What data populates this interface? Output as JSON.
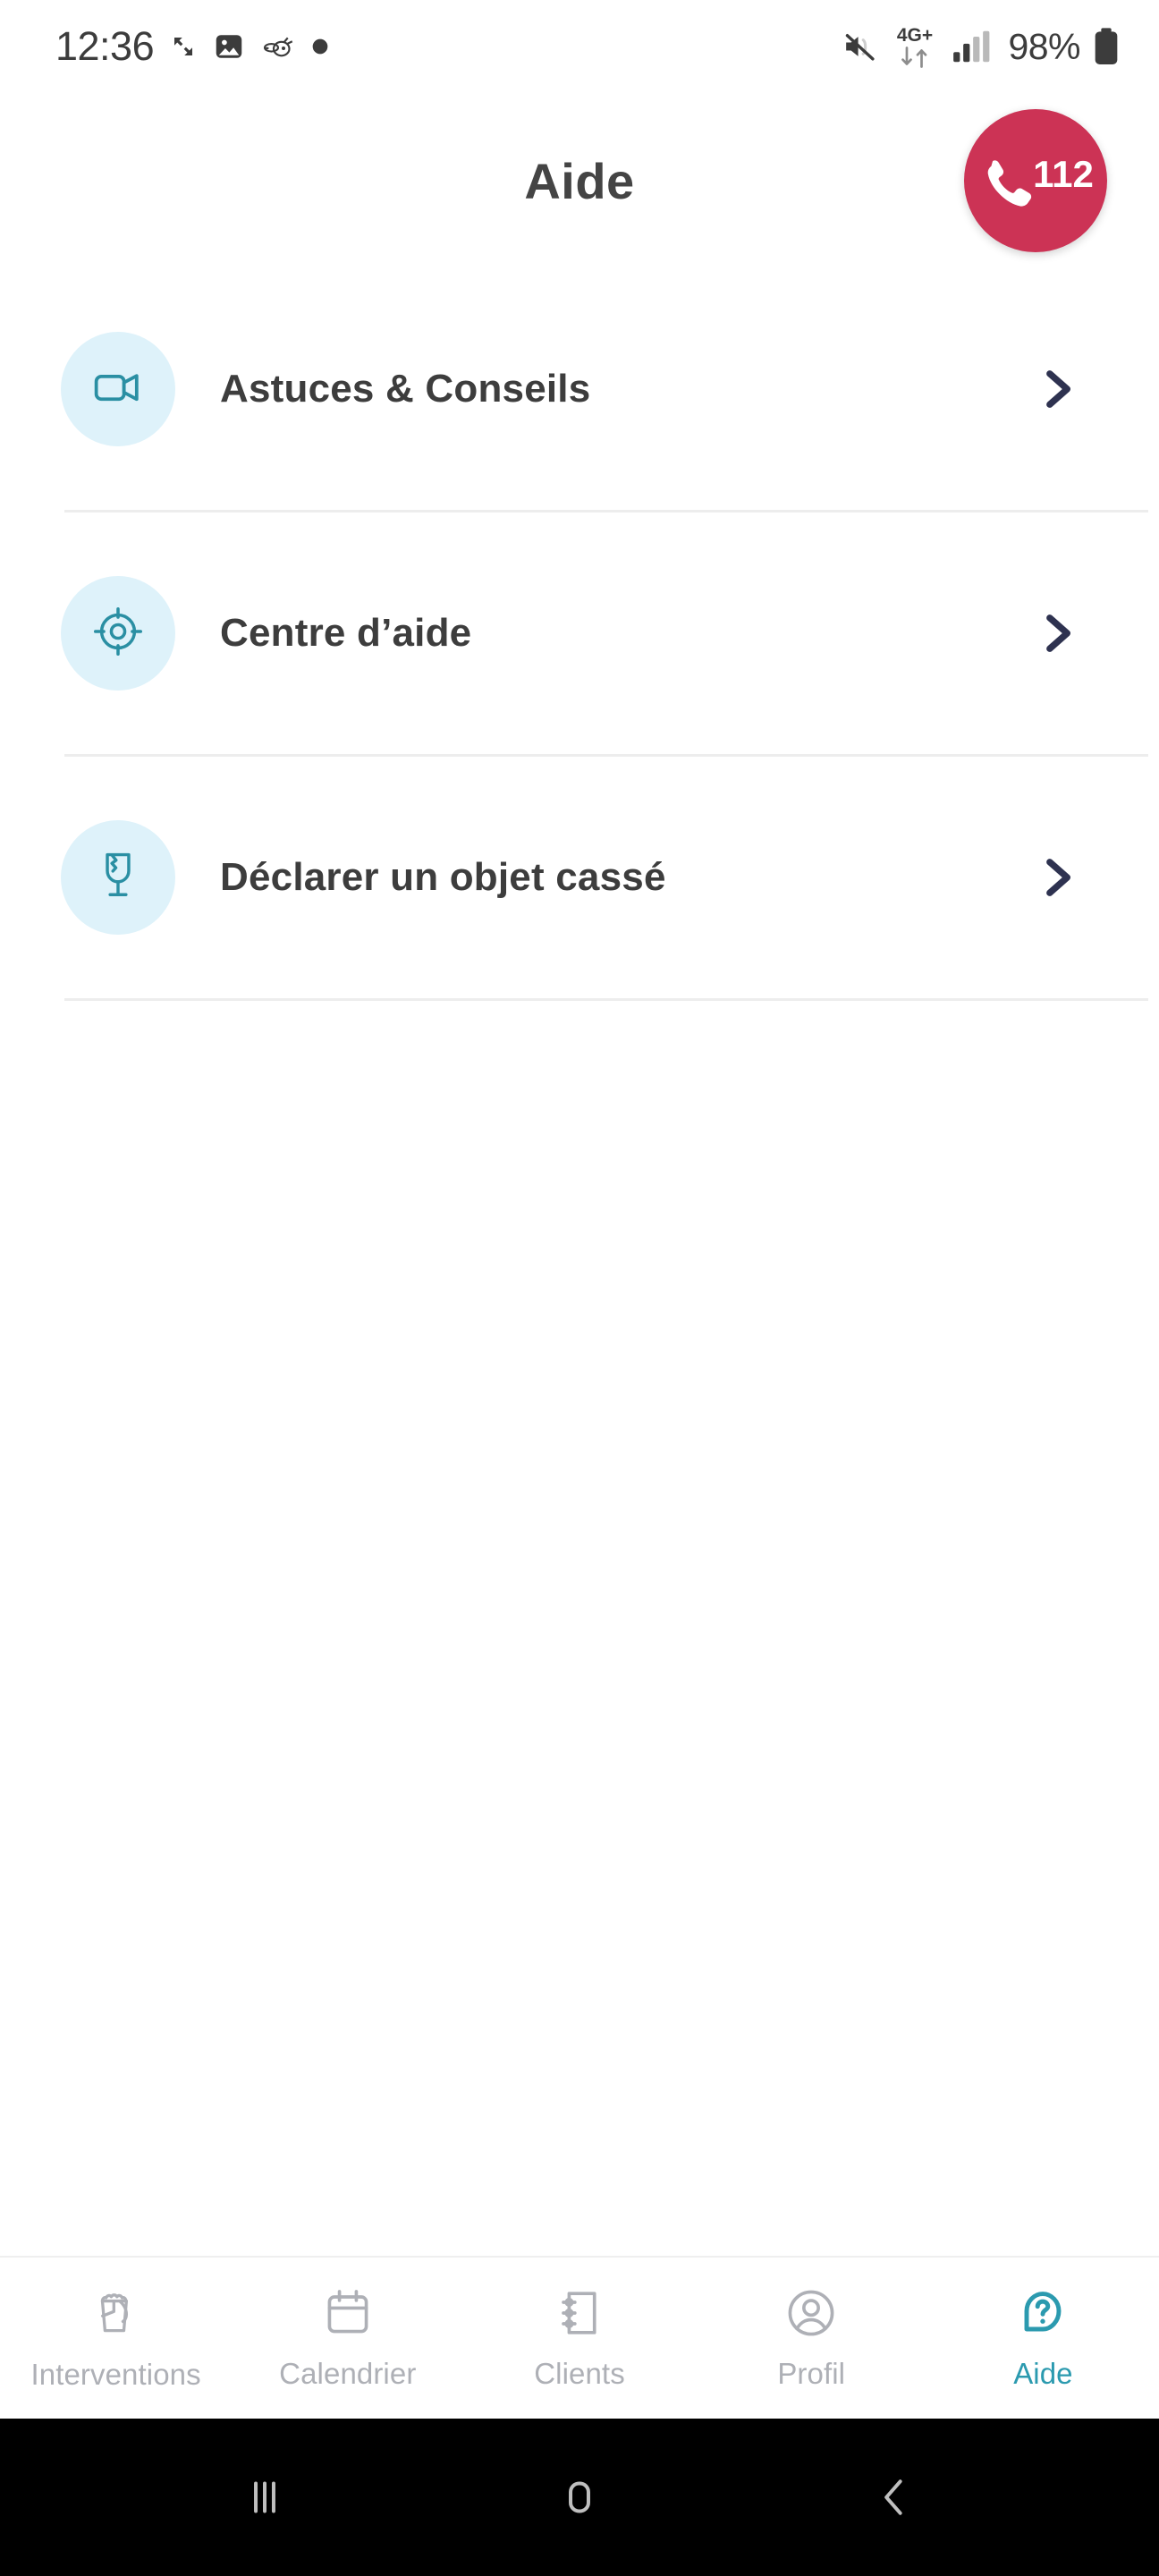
{
  "status_bar": {
    "time": "12:36",
    "battery_percent": "98%",
    "network": "4G+",
    "left_icons": [
      "screen-rotate-icon",
      "image-icon",
      "bee-icon",
      "dot-icon"
    ],
    "right_icons": [
      "mute-icon",
      "network-4gplus-icon",
      "signal-bars-icon",
      "battery-icon"
    ]
  },
  "header": {
    "title": "Aide",
    "emergency": {
      "number": "112",
      "icon": "phone-icon",
      "color": "#CC3355"
    }
  },
  "theme": {
    "accent_teal": "#2B9AAF",
    "icon_bubble_bg": "#DEF2FA",
    "chevron": "#2E3250",
    "text_dark": "#3D3D3D",
    "nav_inactive": "#AEB0B6",
    "divider": "#EDEDED"
  },
  "menu": {
    "items": [
      {
        "label": "Astuces & Conseils",
        "icon": "video-camera-icon",
        "chevron": "chevron-right-icon"
      },
      {
        "label": "Centre d’aide",
        "icon": "target-crosshair-icon",
        "chevron": "chevron-right-icon"
      },
      {
        "label": "Déclarer un objet cassé",
        "icon": "broken-glass-icon",
        "chevron": "chevron-right-icon"
      }
    ]
  },
  "bottom_nav": {
    "items": [
      {
        "label": "Interventions",
        "icon": "cleaning-bucket-icon",
        "active": false
      },
      {
        "label": "Calendrier",
        "icon": "calendar-icon",
        "active": false
      },
      {
        "label": "Clients",
        "icon": "notebook-icon",
        "active": false
      },
      {
        "label": "Profil",
        "icon": "person-circle-icon",
        "active": false
      },
      {
        "label": "Aide",
        "icon": "help-question-icon",
        "active": true
      }
    ]
  },
  "android_nav": {
    "buttons": [
      "recents-icon",
      "home-icon",
      "back-icon"
    ]
  }
}
